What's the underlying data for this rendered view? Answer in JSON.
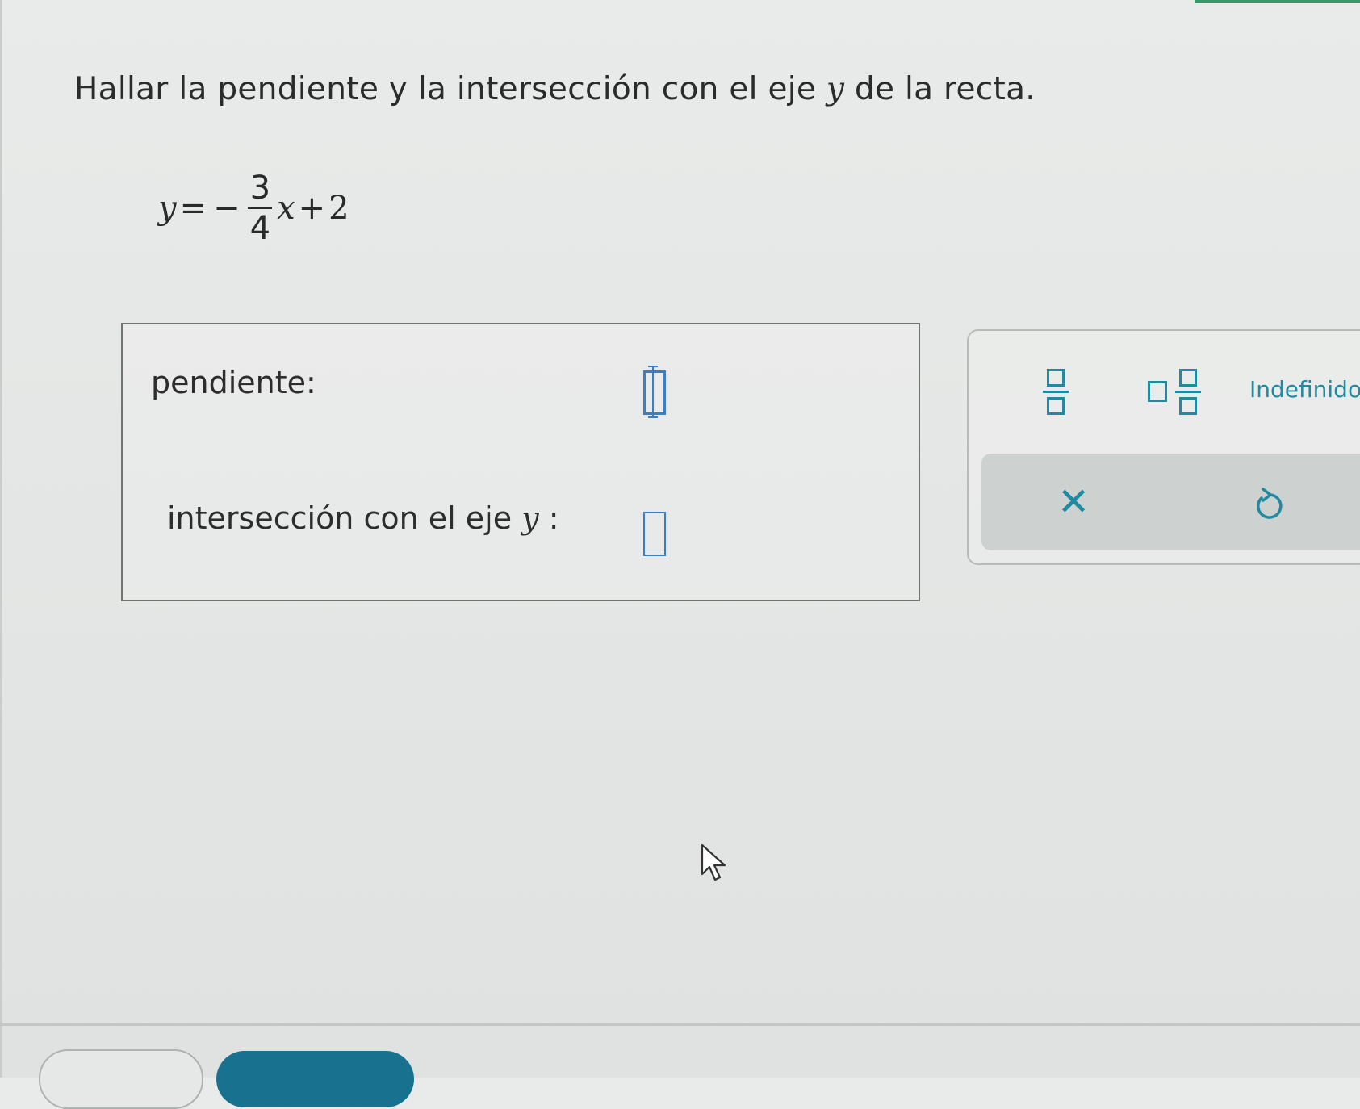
{
  "question": {
    "prompt_before": "Hallar la pendiente y la intersección con el eje ",
    "prompt_var": "y",
    "prompt_after": " de la recta."
  },
  "equation": {
    "lhs": "y",
    "equals": "=",
    "minus": "−",
    "numerator": "3",
    "denominator": "4",
    "variable": "x",
    "plus": "+",
    "constant": "2"
  },
  "answers": {
    "slope_label": "pendiente:",
    "slope_value": "",
    "intercept_label": "intersección con el eje ",
    "intercept_var": "y",
    "intercept_colon": " :",
    "intercept_value": ""
  },
  "palette": {
    "undefined_label": "Indefinido",
    "clear_icon": "close-icon",
    "undo_icon": "undo-icon",
    "accent_color": "#1f8aa0"
  },
  "colors": {
    "input_border": "#3a7ec9",
    "primary_button": "#18718f"
  }
}
